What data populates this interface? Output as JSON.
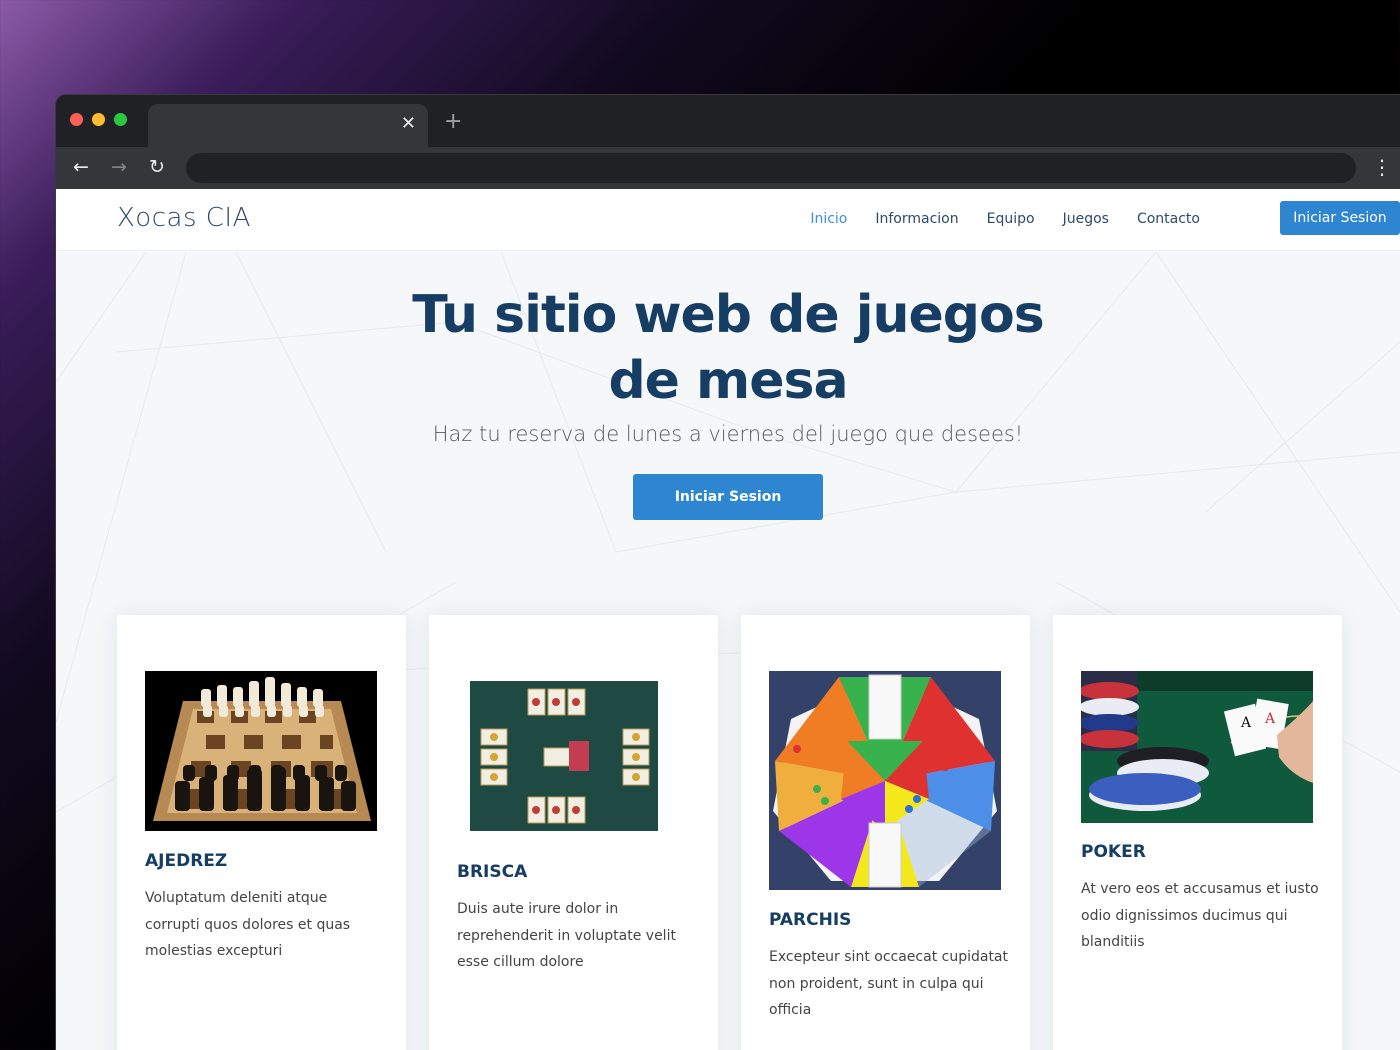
{
  "browser": {
    "window_controls": [
      {
        "name": "close",
        "color": "#ff5f57"
      },
      {
        "name": "minimize",
        "color": "#febc2e"
      },
      {
        "name": "maximize",
        "color": "#28c840"
      }
    ],
    "tab_close_glyph": "✕",
    "new_tab_glyph": "+",
    "back_glyph": "←",
    "forward_glyph": "→",
    "reload_glyph": "↻",
    "menu_glyph": "⋮"
  },
  "site": {
    "logo": "Xocas CIA",
    "nav": [
      {
        "label": "Inicio",
        "active": true
      },
      {
        "label": "Informacion",
        "active": false
      },
      {
        "label": "Equipo",
        "active": false
      },
      {
        "label": "Juegos",
        "active": false
      },
      {
        "label": "Contacto",
        "active": false
      }
    ],
    "login_button": "Iniciar Sesion",
    "accent_color": "#2e86d1",
    "heading_color": "#163d63"
  },
  "hero": {
    "title": "Tu sitio web de juegos de mesa",
    "subtitle": "Haz tu reserva de lunes a viernes del juego que desees!",
    "cta": "Iniciar Sesion"
  },
  "games": [
    {
      "title": "AJEDREZ",
      "text": "Voluptatum deleniti atque corrupti quos dolores et quas molestias excepturi",
      "image": "chess-board"
    },
    {
      "title": "BRISCA",
      "text": "Duis aute irure dolor in reprehenderit in voluptate velit esse cillum dolore",
      "image": "spanish-cards"
    },
    {
      "title": "PARCHIS",
      "text": "Excepteur sint occaecat cupidatat non proident, sunt in culpa qui officia",
      "image": "parchis-board"
    },
    {
      "title": "POKER",
      "text": "At vero eos et accusamus et iusto odio dignissimos ducimus qui blanditiis",
      "image": "poker-chips-aces"
    }
  ]
}
